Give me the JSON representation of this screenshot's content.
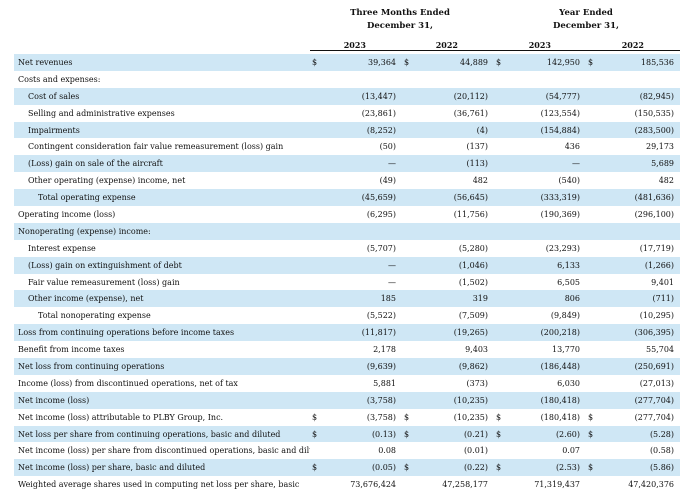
{
  "header": {
    "three_months": [
      "Three Months Ended",
      "December 31,"
    ],
    "year": [
      "Year Ended",
      "December 31,"
    ],
    "years": [
      "2023",
      "2022",
      "2023",
      "2022"
    ]
  },
  "rows": [
    {
      "label": "Net revenues",
      "indent": 0,
      "c": [
        "$",
        "39,364",
        "$",
        "44,889",
        "$",
        "142,950",
        "$",
        "185,536"
      ]
    },
    {
      "label": "Costs and expenses:",
      "indent": 0,
      "c": [
        "",
        "",
        "",
        "",
        "",
        "",
        "",
        ""
      ]
    },
    {
      "label": "Cost of sales",
      "indent": 1,
      "c": [
        "",
        "(13,447)",
        "",
        "(20,112)",
        "",
        "(54,777)",
        "",
        "(82,945)"
      ]
    },
    {
      "label": "Selling and administrative expenses",
      "indent": 1,
      "c": [
        "",
        "(23,861)",
        "",
        "(36,761)",
        "",
        "(123,554)",
        "",
        "(150,535)"
      ]
    },
    {
      "label": "Impairments",
      "indent": 1,
      "c": [
        "",
        "(8,252)",
        "",
        "(4)",
        "",
        "(154,884)",
        "",
        "(283,500)"
      ]
    },
    {
      "label": "Contingent consideration fair value remeasurement (loss) gain",
      "indent": 1,
      "c": [
        "",
        "(50)",
        "",
        "(137)",
        "",
        "436",
        "",
        "29,173"
      ]
    },
    {
      "label": "(Loss) gain on sale of the aircraft",
      "indent": 1,
      "c": [
        "",
        "—",
        "",
        "(113)",
        "",
        "—",
        "",
        "5,689"
      ]
    },
    {
      "label": "Other operating (expense) income, net",
      "indent": 1,
      "c": [
        "",
        "(49)",
        "",
        "482",
        "",
        "(540)",
        "",
        "482"
      ]
    },
    {
      "label": "Total operating expense",
      "indent": 2,
      "c": [
        "",
        "(45,659)",
        "",
        "(56,645)",
        "",
        "(333,319)",
        "",
        "(481,636)"
      ]
    },
    {
      "label": "Operating income (loss)",
      "indent": 0,
      "c": [
        "",
        "(6,295)",
        "",
        "(11,756)",
        "",
        "(190,369)",
        "",
        "(296,100)"
      ]
    },
    {
      "label": "Nonoperating (expense) income:",
      "indent": 0,
      "c": [
        "",
        "",
        "",
        "",
        "",
        "",
        "",
        ""
      ]
    },
    {
      "label": "Interest expense",
      "indent": 1,
      "c": [
        "",
        "(5,707)",
        "",
        "(5,280)",
        "",
        "(23,293)",
        "",
        "(17,719)"
      ]
    },
    {
      "label": "(Loss) gain on extinguishment of debt",
      "indent": 1,
      "c": [
        "",
        "—",
        "",
        "(1,046)",
        "",
        "6,133",
        "",
        "(1,266)"
      ]
    },
    {
      "label": "Fair value remeasurement (loss) gain",
      "indent": 1,
      "c": [
        "",
        "—",
        "",
        "(1,502)",
        "",
        "6,505",
        "",
        "9,401"
      ]
    },
    {
      "label": "Other income (expense), net",
      "indent": 1,
      "c": [
        "",
        "185",
        "",
        "319",
        "",
        "806",
        "",
        "(711)"
      ]
    },
    {
      "label": "Total nonoperating expense",
      "indent": 2,
      "c": [
        "",
        "(5,522)",
        "",
        "(7,509)",
        "",
        "(9,849)",
        "",
        "(10,295)"
      ]
    },
    {
      "label": "Loss from continuing operations before income taxes",
      "indent": 0,
      "c": [
        "",
        "(11,817)",
        "",
        "(19,265)",
        "",
        "(200,218)",
        "",
        "(306,395)"
      ]
    },
    {
      "label": "Benefit from income taxes",
      "indent": 0,
      "c": [
        "",
        "2,178",
        "",
        "9,403",
        "",
        "13,770",
        "",
        "55,704"
      ]
    },
    {
      "label": "Net loss from continuing operations",
      "indent": 0,
      "c": [
        "",
        "(9,639)",
        "",
        "(9,862)",
        "",
        "(186,448)",
        "",
        "(250,691)"
      ]
    },
    {
      "label": "Income (loss) from discontinued operations, net of tax",
      "indent": 0,
      "c": [
        "",
        "5,881",
        "",
        "(373)",
        "",
        "6,030",
        "",
        "(27,013)"
      ]
    },
    {
      "label": "Net income (loss)",
      "indent": 0,
      "c": [
        "",
        "(3,758)",
        "",
        "(10,235)",
        "",
        "(180,418)",
        "",
        "(277,704)"
      ]
    },
    {
      "label": "Net income (loss) attributable to PLBY Group, Inc.",
      "indent": 0,
      "c": [
        "$",
        "(3,758)",
        "$",
        "(10,235)",
        "$",
        "(180,418)",
        "$",
        "(277,704)"
      ]
    },
    {
      "label": "Net loss per share from continuing operations, basic and diluted",
      "indent": 0,
      "c": [
        "$",
        "(0.13)",
        "$",
        "(0.21)",
        "$",
        "(2.60)",
        "$",
        "(5.28)"
      ]
    },
    {
      "label": "Net income (loss) per share from discontinued operations, basic and diluted",
      "indent": 0,
      "c": [
        "",
        "0.08",
        "",
        "(0.01)",
        "",
        "0.07",
        "",
        "(0.58)"
      ]
    },
    {
      "label": "Net income (loss) per share, basic and diluted",
      "indent": 0,
      "c": [
        "$",
        "(0.05)",
        "$",
        "(0.22)",
        "$",
        "(2.53)",
        "$",
        "(5.86)"
      ]
    },
    {
      "label": "Weighted average shares used in computing net loss per share, basic",
      "indent": 0,
      "c": [
        "",
        "73,676,424",
        "",
        "47,258,177",
        "",
        "71,319,437",
        "",
        "47,420,376"
      ]
    }
  ]
}
